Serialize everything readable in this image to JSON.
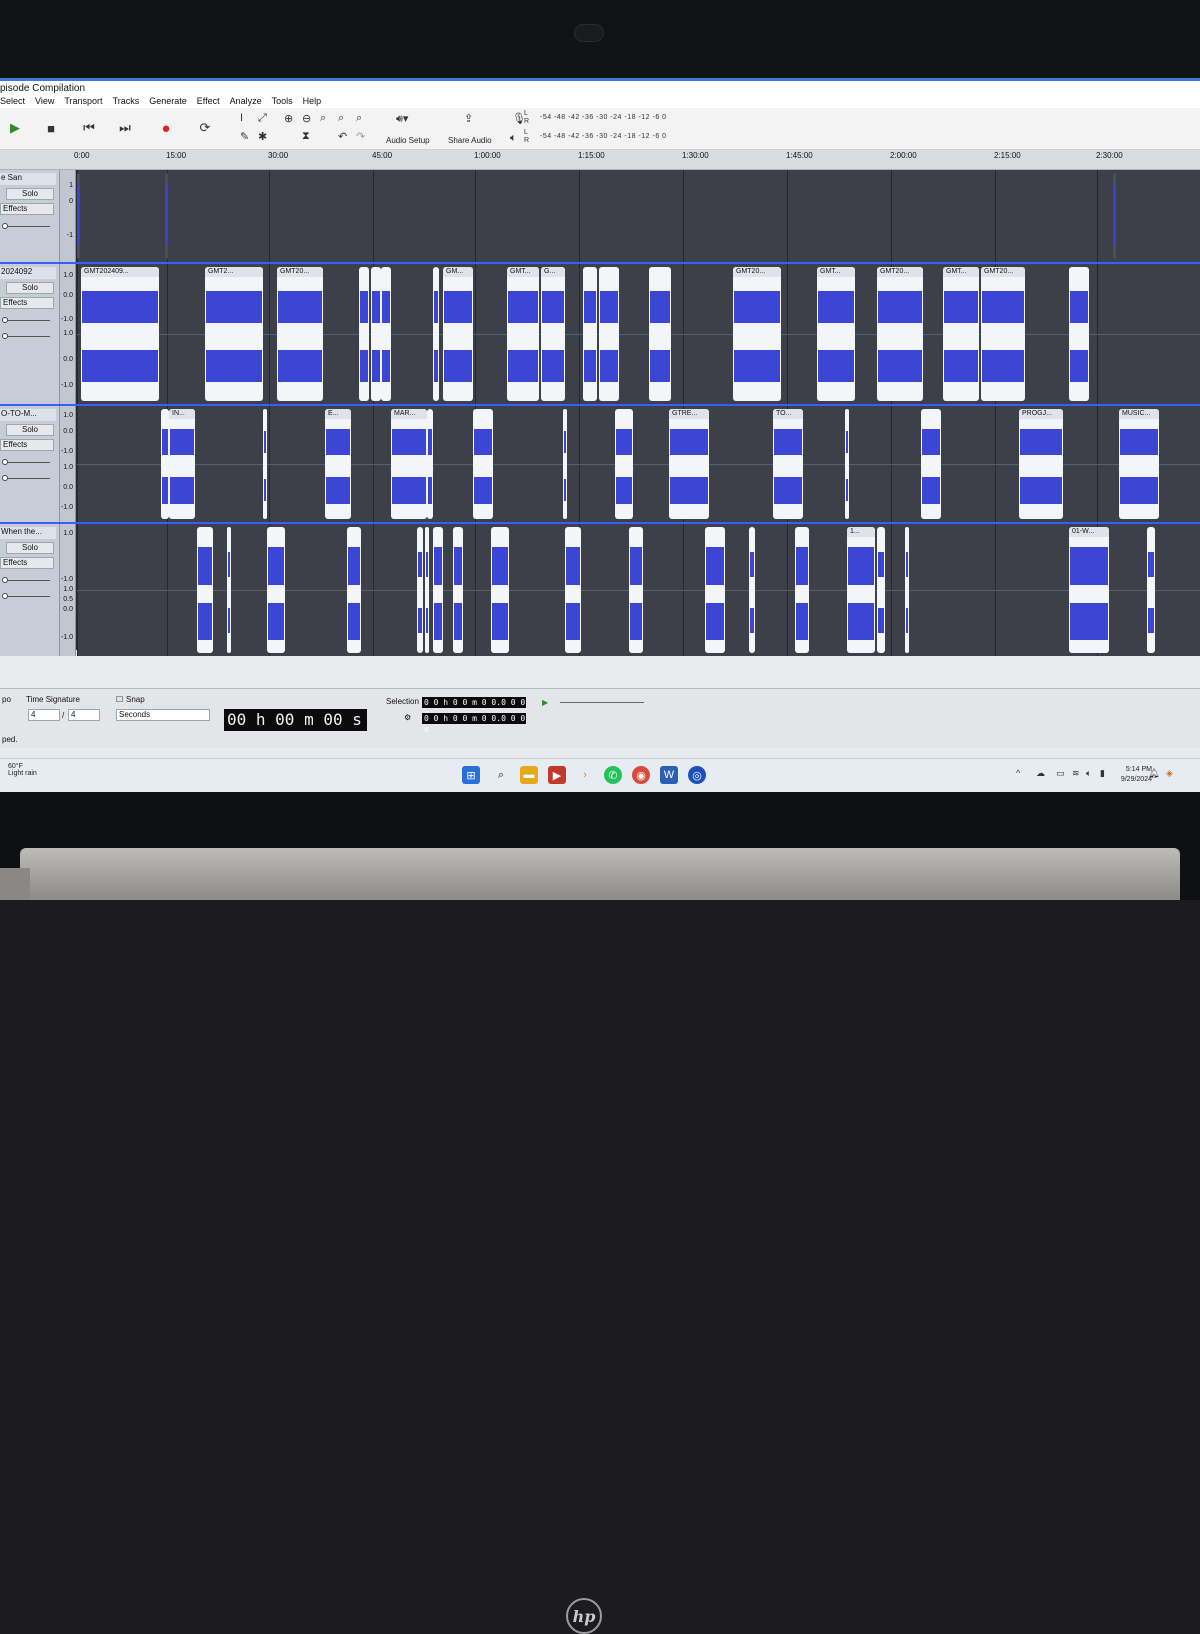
{
  "window": {
    "title": "pisode Compilation"
  },
  "menu": [
    "Select",
    "View",
    "Transport",
    "Tracks",
    "Generate",
    "Effect",
    "Analyze",
    "Tools",
    "Help"
  ],
  "toolbar": {
    "audio_setup": "Audio Setup",
    "share_audio": "Share Audio",
    "meter_scale_rec": "-54 -48 -42 -36 -30 -24 -18 -12 -6 0",
    "meter_scale_play": "-54 -48 -42 -36 -30 -24 -18 -12 -6 0",
    "meter_l": "L",
    "meter_r": "R"
  },
  "ruler": [
    "0:00",
    "15:00",
    "30:00",
    "45:00",
    "1:00:00",
    "1:15:00",
    "1:30:00",
    "1:45:00",
    "2:00:00",
    "2:15:00",
    "2:30:00"
  ],
  "tracks": [
    {
      "name": "e San",
      "solo": "Solo",
      "effects": "Effects",
      "scale": [
        "1",
        "0",
        "-1"
      ]
    },
    {
      "name": "2024092",
      "solo": "Solo",
      "effects": "Effects",
      "scale": [
        "1.0",
        "0.0",
        "-1.0",
        "1.0",
        "0.0",
        "-1.0"
      ]
    },
    {
      "name": "O-TO-M...",
      "solo": "Solo",
      "effects": "Effects",
      "scale": [
        "1.0",
        "0.0",
        "-1.0",
        "1.0",
        "0.0",
        "-1.0"
      ]
    },
    {
      "name": "When the...",
      "solo": "Solo",
      "effects": "Effects",
      "scale": [
        "1.0",
        "-1.0",
        "1.0",
        "0.5",
        "0.0",
        "-1.0"
      ]
    }
  ],
  "clips": {
    "t2": [
      "GMT202409...",
      "GMT2...",
      "GMT20...",
      "GM...",
      "GMT...",
      "G...",
      "GMT20...",
      "GMT...",
      "GMT20...",
      "GMT...",
      "GMT20..."
    ],
    "t3": [
      "IN...",
      "E...",
      "MAR...",
      "GTRE...",
      "TO...",
      "PROGJ...",
      "MUSIC..."
    ],
    "t4": [
      "1...",
      "01-W..."
    ]
  },
  "bottom": {
    "tempo_label": "po",
    "time_sig_label": "Time Signature",
    "ts_num": "4",
    "ts_den": "4",
    "snap_label": "Snap",
    "snap_unit": "Seconds",
    "time": "00 h 00 m 00 s",
    "selection_label": "Selection",
    "sel_start": "0 0 h 0 0 m 0 0.0 0 0 s",
    "sel_end": "0 0 h 0 0 m 0 0.0 0 0 s",
    "status": "ped."
  },
  "taskbar": {
    "temp": "60°F",
    "weather": "Light rain",
    "time": "5:14 PM",
    "date": "9/29/2024"
  },
  "brand": {
    "laptop": "hp"
  },
  "colors": {
    "waveform": "#3c46d4",
    "clip_bg": "#f4f5f8",
    "lane_bg": "#3d4049",
    "selection_bar": "#3b5cff"
  }
}
